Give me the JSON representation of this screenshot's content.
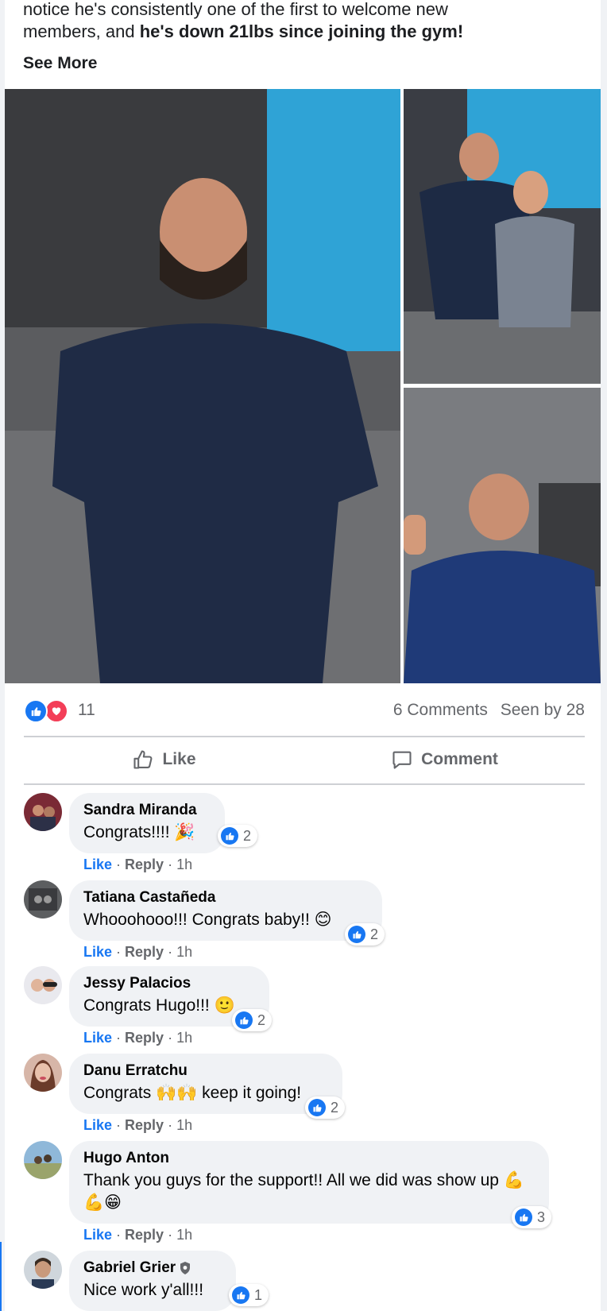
{
  "post": {
    "text_line1": "notice he's consistently one of the first to welcome new",
    "text_line2_plain": "members, and ",
    "text_line2_bold": "he's down 21lbs since joining the gym!",
    "see_more": "See More"
  },
  "photos": [
    {
      "name": "main-photo",
      "desc_icon": "man-smiling-in-gym-photo"
    },
    {
      "name": "pair-photo",
      "desc_icon": "two-people-posing-photo"
    },
    {
      "name": "floor-photo",
      "desc_icon": "man-lying-thumbs-up-photo"
    }
  ],
  "stats": {
    "reaction_count": "11",
    "comments": "6 Comments",
    "seen_by": "Seen by 28"
  },
  "actions": {
    "like": "Like",
    "comment": "Comment"
  },
  "comments": [
    {
      "name": "Sandra Miranda",
      "text": "Congrats!!!! 🎉",
      "likes": "2",
      "like": "Like",
      "reply": "Reply",
      "time": "1h"
    },
    {
      "name": "Tatiana Castañeda",
      "text": "Whooohooo!!! Congrats baby!! 😊",
      "likes": "2",
      "like": "Like",
      "reply": "Reply",
      "time": "1h"
    },
    {
      "name": "Jessy Palacios",
      "text": "Congrats Hugo!!! 🙂",
      "likes": "2",
      "like": "Like",
      "reply": "Reply",
      "time": "1h"
    },
    {
      "name": "Danu Erratchu",
      "text": "Congrats 🙌🙌 keep it going!",
      "likes": "2",
      "like": "Like",
      "reply": "Reply",
      "time": "1h"
    },
    {
      "name": "Hugo Anton",
      "text": "Thank you guys for the support!! All we did was show up 💪💪😁",
      "likes": "3",
      "like": "Like",
      "reply": "Reply",
      "time": "1h"
    },
    {
      "name": "Gabriel Grier",
      "text": "Nice work y'all!!!",
      "likes": "1"
    }
  ],
  "colors": {
    "accent": "#1877f2",
    "love": "#f33e58",
    "muted": "#65676b",
    "bubble": "#f0f2f5"
  }
}
